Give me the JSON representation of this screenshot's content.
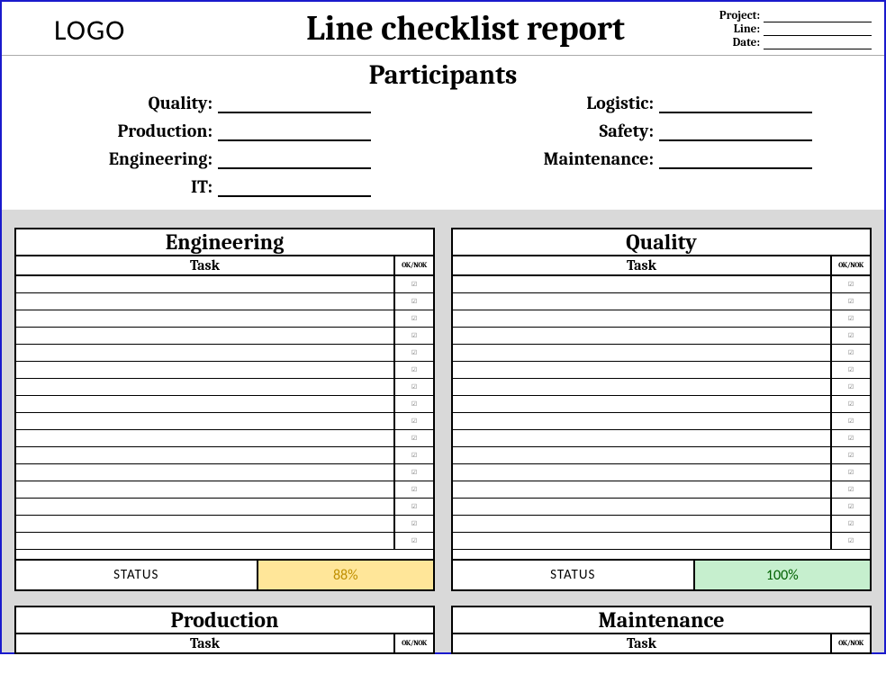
{
  "header": {
    "logo": "LOGO",
    "title": "Line checklist report",
    "meta": {
      "project_label": "Project:",
      "line_label": "Line:",
      "date_label": "Date:"
    }
  },
  "participants": {
    "title": "Participants",
    "left": {
      "quality": "Quality:",
      "production": "Production:",
      "engineering": "Engineering:",
      "it": "IT:"
    },
    "right": {
      "logistic": "Logistic:",
      "safety": "Safety:",
      "maintenance": "Maintenance:"
    }
  },
  "cards": {
    "engineering": {
      "title": "Engineering",
      "task_header": "Task",
      "ok_header": "OK/NOK",
      "rows": 16,
      "status_label": "STATUS",
      "status_value": "88%",
      "status_class": "warn"
    },
    "quality": {
      "title": "Quality",
      "task_header": "Task",
      "ok_header": "OK/NOK",
      "rows": 16,
      "status_label": "STATUS",
      "status_value": "100%",
      "status_class": "ok"
    },
    "production": {
      "title": "Production",
      "task_header": "Task",
      "ok_header": "OK/NOK"
    },
    "maintenance": {
      "title": "Maintenance",
      "task_header": "Task",
      "ok_header": "OK/NOK"
    }
  }
}
